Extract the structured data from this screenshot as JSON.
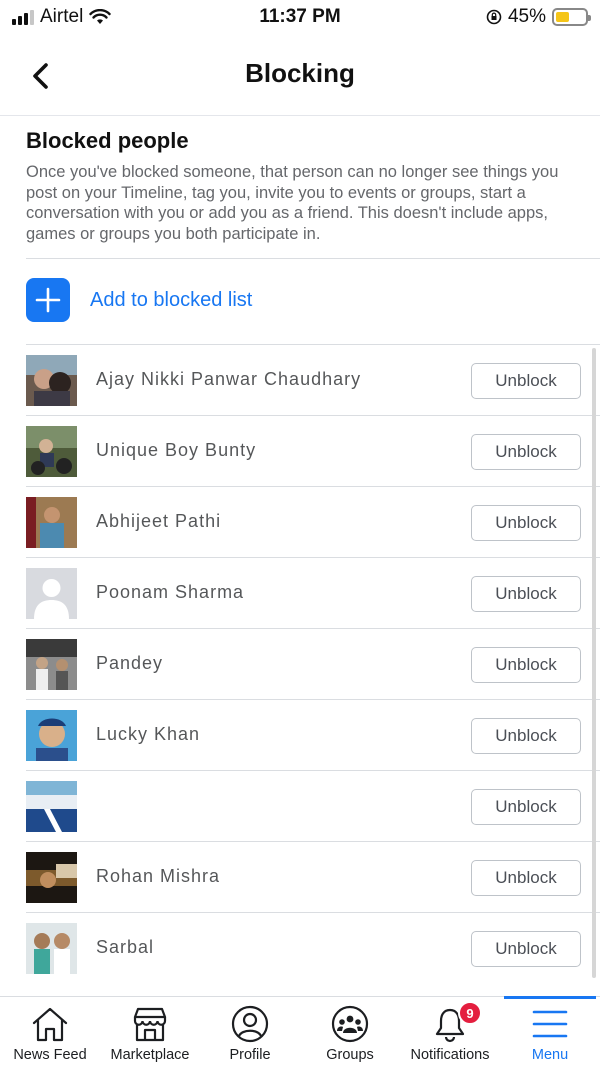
{
  "status_bar": {
    "carrier": "Airtel",
    "time": "11:37 PM",
    "battery": "45%",
    "battery_level": 0.45
  },
  "header": {
    "title": "Blocking",
    "back_icon": "chevron-left-icon"
  },
  "section": {
    "title": "Blocked people",
    "description": "Once you've blocked someone, that person can no longer see things you post on your Timeline, tag you, invite you to events or groups, start a conversation with you or add you as a friend. This doesn't include apps, games or groups you both participate in."
  },
  "add": {
    "label": "Add to blocked list",
    "icon": "plus-icon"
  },
  "blocked": [
    {
      "name": "Ajay Nikki Panwar Chaudhary",
      "button": "Unblock"
    },
    {
      "name": "Unique Boy Bunty",
      "button": "Unblock"
    },
    {
      "name": "Abhijeet Pathi",
      "button": "Unblock"
    },
    {
      "name": "Poonam Sharma",
      "button": "Unblock"
    },
    {
      "name": "Pandey",
      "button": "Unblock"
    },
    {
      "name": "Lucky Khan",
      "button": "Unblock"
    },
    {
      "name": "",
      "button": "Unblock"
    },
    {
      "name": "Rohan Mishra",
      "button": "Unblock"
    },
    {
      "name": "Sarbal",
      "button": "Unblock"
    }
  ],
  "tabs": [
    {
      "label": "News Feed",
      "icon": "home-icon"
    },
    {
      "label": "Marketplace",
      "icon": "store-icon"
    },
    {
      "label": "Profile",
      "icon": "profile-icon"
    },
    {
      "label": "Groups",
      "icon": "groups-icon"
    },
    {
      "label": "Notifications",
      "icon": "bell-icon",
      "badge": "9"
    },
    {
      "label": "Menu",
      "icon": "menu-icon",
      "active": true
    }
  ],
  "colors": {
    "accent": "#1877f2",
    "badge": "#e41e3f",
    "battery": "#f5c518"
  }
}
